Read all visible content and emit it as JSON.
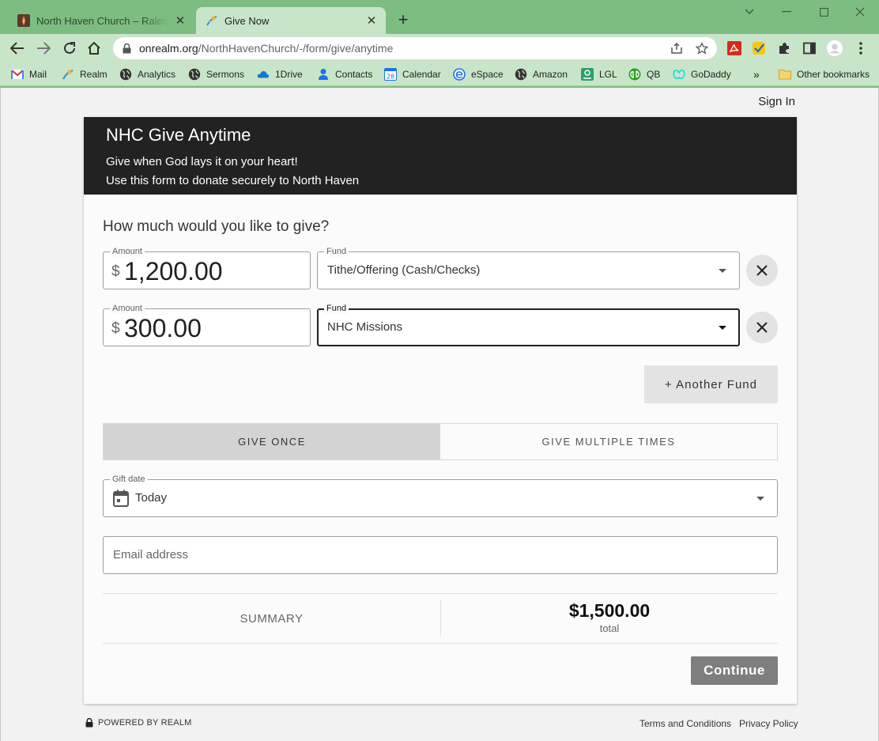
{
  "browser": {
    "tabs": [
      {
        "title": "North Haven Church – Raleigh, N",
        "active": false
      },
      {
        "title": "Give Now",
        "active": true
      }
    ],
    "new_tab_label": "+",
    "url_host": "onrealm.org",
    "url_path": "/NorthHavenChurch/-/form/give/anytime",
    "bookmarks": [
      {
        "label": "Mail",
        "icon": "gmail-icon"
      },
      {
        "label": "Realm",
        "icon": "realm-icon"
      },
      {
        "label": "Analytics",
        "icon": "globe-icon"
      },
      {
        "label": "Sermons",
        "icon": "globe-icon"
      },
      {
        "label": "1Drive",
        "icon": "cloud-icon"
      },
      {
        "label": "Contacts",
        "icon": "person-icon"
      },
      {
        "label": "Calendar",
        "icon": "calendar-icon"
      },
      {
        "label": "eSpace",
        "icon": "espace-icon"
      },
      {
        "label": "Amazon",
        "icon": "globe-icon"
      },
      {
        "label": "LGL",
        "icon": "lgl-icon"
      },
      {
        "label": "QB",
        "icon": "quickbooks-icon"
      },
      {
        "label": "GoDaddy",
        "icon": "godaddy-icon"
      }
    ],
    "overflow_label": "»",
    "other_bookmarks": "Other bookmarks",
    "calendar_icon_day": "28"
  },
  "page": {
    "sign_in": "Sign In",
    "header": {
      "title": "NHC Give Anytime",
      "line1": "Give when God lays it on your heart!",
      "line2": "Use this form to donate securely to North Haven"
    },
    "question": "How much would you like to give?",
    "gifts": [
      {
        "amount_label": "Amount",
        "currency": "$",
        "amount": "1,200.00",
        "fund_label": "Fund",
        "fund": "Tithe/Offering (Cash/Checks)"
      },
      {
        "amount_label": "Amount",
        "currency": "$",
        "amount": "300.00",
        "fund_label": "Fund",
        "fund": "NHC Missions"
      }
    ],
    "another_fund": "+ Another Fund",
    "frequency": {
      "once": "GIVE ONCE",
      "multiple": "GIVE MULTIPLE TIMES",
      "selected": "once"
    },
    "gift_date": {
      "label": "Gift date",
      "value": "Today"
    },
    "email": {
      "placeholder": "Email address"
    },
    "summary": {
      "label": "SUMMARY",
      "total": "$1,500.00",
      "total_label": "total"
    },
    "continue": "Continue",
    "footer": {
      "powered_by": "POWERED BY REALM",
      "terms": "Terms and Conditions",
      "privacy": "Privacy Policy"
    }
  },
  "colors": {
    "chrome_frame": "#7dbd82",
    "chrome_toolbar": "#c9e5c9",
    "header_bg": "#222222",
    "button_gray": "#7e7e7e"
  }
}
